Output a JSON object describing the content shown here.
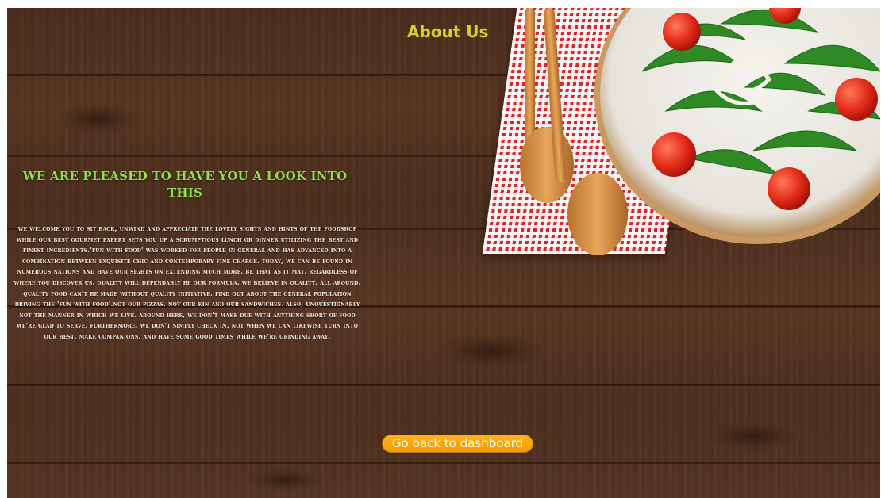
{
  "page": {
    "title": "About Us"
  },
  "content": {
    "headline": "We are pleased to have you a look into this",
    "body": "We welcome you to sit back, unwind and appreciate the lovely sights and hints of the foodshop while our best gourmet expert sets you up a scrumptious lunch or dinner utilizing the best and finest ingredients.'Fun with food' was worked for people in general and has advanced into a combination between exQuisite chic and contemporary fine charge. Today, we can be found in numerous nations and have our sights on extending much more. Be that as it may, regardless of where you discover us, Quality will dependably be our formula. We believe in Quality. All around. Quality food can't be made without Quality initiative. Find out about the general population driving the 'Fun with food'.Not our pizzas. Not our kin and our sandwiches. Also, unQuestionably not the manner in which we live. Around here, we don't make due with anything short of food we're glad to serve. Furthermore, we don't simply check in. Not when we can likewise turn into our best, make companions, and have some good times while we're grinding away."
  },
  "actions": {
    "back_label": "Go back to dashboard"
  },
  "colors": {
    "title": "#d5d32b",
    "headline": "#8ee04a",
    "body_text": "#f4efe9",
    "button": "#f29b00",
    "wood": "#4f2f1e"
  },
  "icons": {
    "background": "wood-table-background",
    "plate": "salad-plate-image",
    "spoons": "wooden-spoons-image",
    "napkin": "checkered-napkin-image"
  }
}
